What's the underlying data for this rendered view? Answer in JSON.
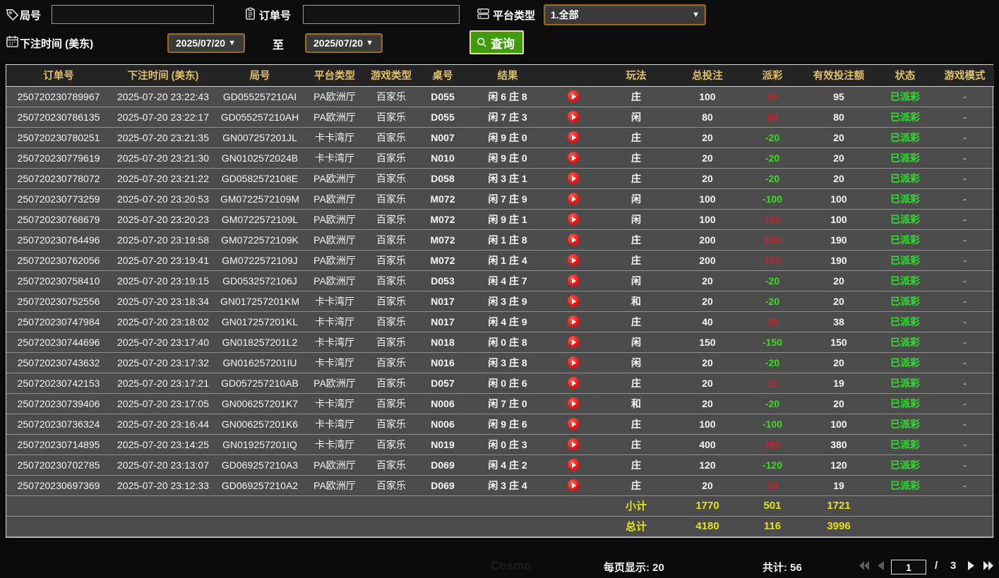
{
  "topbar": {
    "game_no_label": "局号",
    "game_no_value": "",
    "order_no_label": "订单号",
    "order_no_value": "",
    "platform_label": "平台类型",
    "platform_value": "1.全部",
    "bet_time_label": "下注时间 (美东)",
    "date_from": "2025/07/20",
    "to_label": "至",
    "date_to": "2025/07/20",
    "search_label": "查询"
  },
  "table": {
    "headers": [
      "订单号",
      "下注时间 (美东)",
      "局号",
      "平台类型",
      "游戏类型",
      "桌号",
      "结果",
      "",
      "玩法",
      "总投注",
      "派彩",
      "有效投注额",
      "状态",
      "游戏模式"
    ],
    "rows": [
      [
        "250720230789967",
        "2025-07-20 23:22:43",
        "GD055257210AI",
        "PA欧洲厅",
        "百家乐",
        "D055",
        "闲 6 庄 8",
        "庄",
        "100",
        "95",
        "95",
        "已派彩",
        "-"
      ],
      [
        "250720230786135",
        "2025-07-20 23:22:17",
        "GD055257210AH",
        "PA欧洲厅",
        "百家乐",
        "D055",
        "闲 7 庄 3",
        "闲",
        "80",
        "80",
        "80",
        "已派彩",
        "-"
      ],
      [
        "250720230780251",
        "2025-07-20 23:21:35",
        "GN007257201JL",
        "卡卡湾厅",
        "百家乐",
        "N007",
        "闲 9 庄 0",
        "庄",
        "20",
        "-20",
        "20",
        "已派彩",
        "-"
      ],
      [
        "250720230779619",
        "2025-07-20 23:21:30",
        "GN0102572024B",
        "卡卡湾厅",
        "百家乐",
        "N010",
        "闲 9 庄 0",
        "庄",
        "20",
        "-20",
        "20",
        "已派彩",
        "-"
      ],
      [
        "250720230778072",
        "2025-07-20 23:21:22",
        "GD0582572108E",
        "PA欧洲厅",
        "百家乐",
        "D058",
        "闲 3 庄 1",
        "庄",
        "20",
        "-20",
        "20",
        "已派彩",
        "-"
      ],
      [
        "250720230773259",
        "2025-07-20 23:20:53",
        "GM0722572109M",
        "PA欧洲厅",
        "百家乐",
        "M072",
        "闲 7 庄 9",
        "闲",
        "100",
        "-100",
        "100",
        "已派彩",
        "-"
      ],
      [
        "250720230768679",
        "2025-07-20 23:20:23",
        "GM0722572109L",
        "PA欧洲厅",
        "百家乐",
        "M072",
        "闲 9 庄 1",
        "闲",
        "100",
        "100",
        "100",
        "已派彩",
        "-"
      ],
      [
        "250720230764496",
        "2025-07-20 23:19:58",
        "GM0722572109K",
        "PA欧洲厅",
        "百家乐",
        "M072",
        "闲 1 庄 8",
        "庄",
        "200",
        "190",
        "190",
        "已派彩",
        "-"
      ],
      [
        "250720230762056",
        "2025-07-20 23:19:41",
        "GM0722572109J",
        "PA欧洲厅",
        "百家乐",
        "M072",
        "闲 1 庄 4",
        "庄",
        "200",
        "190",
        "190",
        "已派彩",
        "-"
      ],
      [
        "250720230758410",
        "2025-07-20 23:19:15",
        "GD0532572106J",
        "PA欧洲厅",
        "百家乐",
        "D053",
        "闲 4 庄 7",
        "闲",
        "20",
        "-20",
        "20",
        "已派彩",
        "-"
      ],
      [
        "250720230752556",
        "2025-07-20 23:18:34",
        "GN017257201KM",
        "卡卡湾厅",
        "百家乐",
        "N017",
        "闲 3 庄 9",
        "和",
        "20",
        "-20",
        "20",
        "已派彩",
        "-"
      ],
      [
        "250720230747984",
        "2025-07-20 23:18:02",
        "GN017257201KL",
        "卡卡湾厅",
        "百家乐",
        "N017",
        "闲 4 庄 9",
        "庄",
        "40",
        "38",
        "38",
        "已派彩",
        "-"
      ],
      [
        "250720230744696",
        "2025-07-20 23:17:40",
        "GN018257201L2",
        "卡卡湾厅",
        "百家乐",
        "N018",
        "闲 0 庄 8",
        "闲",
        "150",
        "-150",
        "150",
        "已派彩",
        "-"
      ],
      [
        "250720230743632",
        "2025-07-20 23:17:32",
        "GN016257201IU",
        "卡卡湾厅",
        "百家乐",
        "N016",
        "闲 3 庄 8",
        "闲",
        "20",
        "-20",
        "20",
        "已派彩",
        "-"
      ],
      [
        "250720230742153",
        "2025-07-20 23:17:21",
        "GD057257210AB",
        "PA欧洲厅",
        "百家乐",
        "D057",
        "闲 0 庄 6",
        "庄",
        "20",
        "19",
        "19",
        "已派彩",
        "-"
      ],
      [
        "250720230739406",
        "2025-07-20 23:17:05",
        "GN006257201K7",
        "卡卡湾厅",
        "百家乐",
        "N006",
        "闲 7 庄 0",
        "和",
        "20",
        "-20",
        "20",
        "已派彩",
        "-"
      ],
      [
        "250720230736324",
        "2025-07-20 23:16:44",
        "GN006257201K6",
        "卡卡湾厅",
        "百家乐",
        "N006",
        "闲 9 庄 6",
        "庄",
        "100",
        "-100",
        "100",
        "已派彩",
        "-"
      ],
      [
        "250720230714895",
        "2025-07-20 23:14:25",
        "GN019257201IQ",
        "卡卡湾厅",
        "百家乐",
        "N019",
        "闲 0 庄 3",
        "庄",
        "400",
        "380",
        "380",
        "已派彩",
        "-"
      ],
      [
        "250720230702785",
        "2025-07-20 23:13:07",
        "GD069257210A3",
        "PA欧洲厅",
        "百家乐",
        "D069",
        "闲 4 庄 2",
        "庄",
        "120",
        "-120",
        "120",
        "已派彩",
        "-"
      ],
      [
        "250720230697369",
        "2025-07-20 23:12:33",
        "GD069257210A2",
        "PA欧洲厅",
        "百家乐",
        "D069",
        "闲 3 庄 4",
        "庄",
        "20",
        "19",
        "19",
        "已派彩",
        "-"
      ]
    ],
    "subtotal": {
      "label": "小计",
      "total_bet": "1770",
      "payout": "501",
      "valid_bet": "1721"
    },
    "total": {
      "label": "总计",
      "total_bet": "4180",
      "payout": "116",
      "valid_bet": "3996"
    }
  },
  "footer": {
    "per_page_label": "每页显示: 20",
    "total_label": "共计: 56",
    "page": "1",
    "page_sep": "/",
    "total_pages": "3"
  },
  "watermark": "Cosmo",
  "colors": {
    "header_gold": "#dfc06c",
    "win_red": "#c2232e",
    "loss_green": "#3ade1e",
    "status_green": "#2ee02e",
    "summary_yellow": "#e6e312",
    "search_button_green": "#3f9c0d",
    "dropdown_border_brown": "#9c6620",
    "row_bg": "#4c4c4c",
    "header_bg": "#242424",
    "play_icon_red": "#e01414"
  }
}
